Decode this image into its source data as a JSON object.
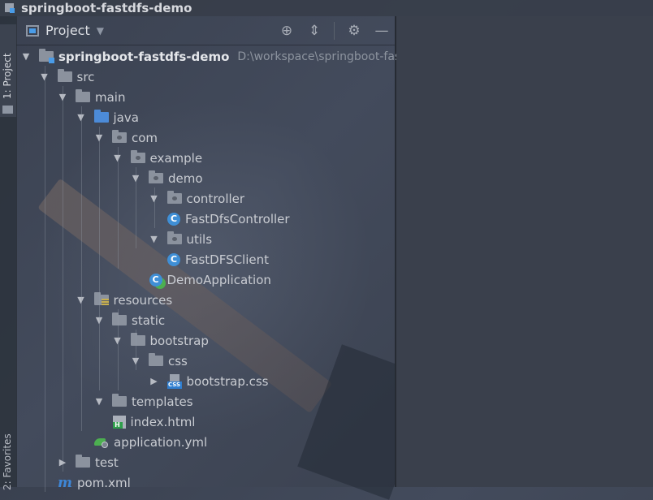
{
  "window": {
    "title": "springboot-fastdfs-demo"
  },
  "toolstrip": {
    "project_tab": "1: Project",
    "favorites_tab": "2: Favorites"
  },
  "panel": {
    "title": "Project"
  },
  "tree": [
    {
      "label": "springboot-fastdfs-demo",
      "path": "D:\\workspace\\springboot-fas",
      "indent": 0,
      "arrow": "down",
      "icon": "module-folder-icon",
      "bold": true
    },
    {
      "label": "src",
      "indent": 1,
      "arrow": "down",
      "icon": "folder-icon"
    },
    {
      "label": "main",
      "indent": 2,
      "arrow": "down",
      "icon": "folder-icon"
    },
    {
      "label": "java",
      "indent": 3,
      "arrow": "down",
      "icon": "source-folder-icon"
    },
    {
      "label": "com",
      "indent": 4,
      "arrow": "down",
      "icon": "package-icon"
    },
    {
      "label": "example",
      "indent": 5,
      "arrow": "down",
      "icon": "package-icon"
    },
    {
      "label": "demo",
      "indent": 6,
      "arrow": "down",
      "icon": "package-icon"
    },
    {
      "label": "controller",
      "indent": 7,
      "arrow": "down",
      "icon": "package-icon"
    },
    {
      "label": "FastDfsController",
      "indent": 8,
      "arrow": "none",
      "icon": "class-icon"
    },
    {
      "label": "utils",
      "indent": 7,
      "arrow": "down",
      "icon": "package-icon"
    },
    {
      "label": "FastDFSClient",
      "indent": 8,
      "arrow": "none",
      "icon": "class-icon"
    },
    {
      "label": "DemoApplication",
      "indent": 7,
      "arrow": "none",
      "icon": "spring-app-class-icon"
    },
    {
      "label": "resources",
      "indent": 3,
      "arrow": "down",
      "icon": "resources-folder-icon"
    },
    {
      "label": "static",
      "indent": 4,
      "arrow": "down",
      "icon": "folder-icon"
    },
    {
      "label": "bootstrap",
      "indent": 5,
      "arrow": "down",
      "icon": "folder-icon"
    },
    {
      "label": "css",
      "indent": 6,
      "arrow": "down",
      "icon": "folder-icon"
    },
    {
      "label": "bootstrap.css",
      "indent": 7,
      "arrow": "right",
      "icon": "css-file-icon"
    },
    {
      "label": "templates",
      "indent": 4,
      "arrow": "down",
      "icon": "folder-icon"
    },
    {
      "label": "index.html",
      "indent": 5,
      "arrow": "none",
      "icon": "html-file-icon"
    },
    {
      "label": "application.yml",
      "indent": 4,
      "arrow": "none",
      "icon": "spring-yml-icon"
    },
    {
      "label": "test",
      "indent": 2,
      "arrow": "right",
      "icon": "folder-icon"
    },
    {
      "label": "pom.xml",
      "indent": 2,
      "arrow": "none",
      "icon": "maven-icon"
    }
  ]
}
